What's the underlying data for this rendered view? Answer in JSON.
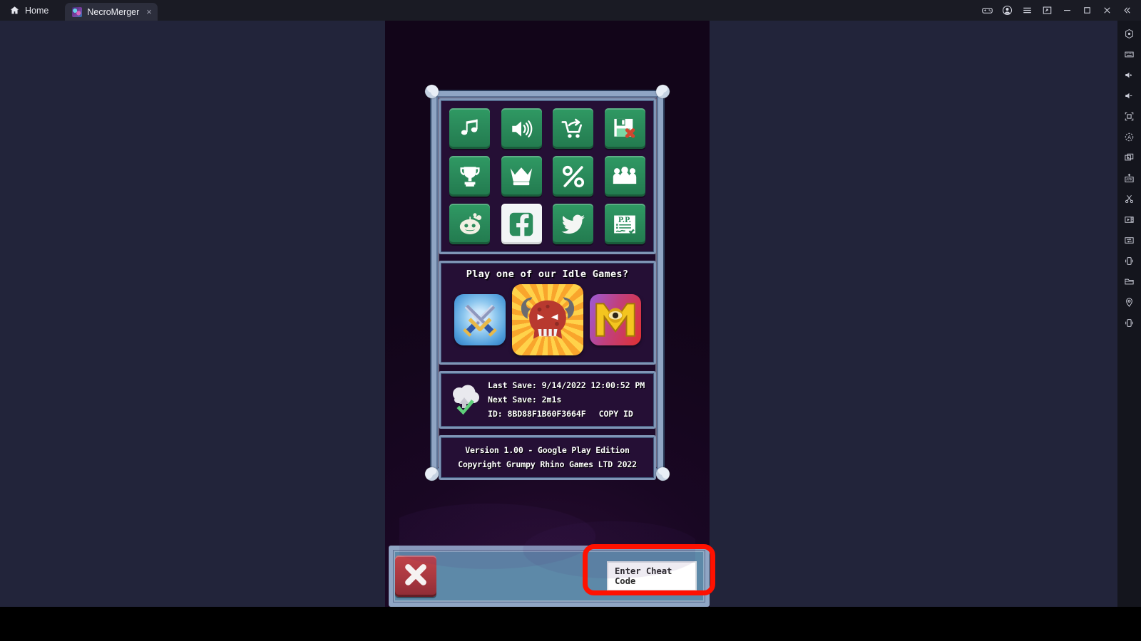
{
  "titlebar": {
    "home_label": "Home",
    "home_icon": "home-icon",
    "game_tab_label": "NecroMerger",
    "tab_close_glyph": "×",
    "buttons": [
      {
        "name": "gamepad-icon",
        "label": "Gamepad"
      },
      {
        "name": "account-icon",
        "label": "Account"
      },
      {
        "name": "hamburger-menu-icon",
        "label": "Menu"
      },
      {
        "name": "screenshot-icon",
        "label": "Screenshot"
      },
      {
        "name": "minimize-icon",
        "label": "Minimize"
      },
      {
        "name": "maximize-icon",
        "label": "Maximize"
      },
      {
        "name": "close-icon",
        "label": "Close"
      },
      {
        "name": "collapse-chevrons-icon",
        "label": "Collapse"
      }
    ]
  },
  "rail": {
    "items": [
      {
        "name": "fullscreen-hex-icon",
        "label": "Fullscreen"
      },
      {
        "name": "keyboard-icon",
        "label": "Keyboard mapping"
      },
      {
        "name": "volume-up-icon",
        "label": "Volume up"
      },
      {
        "name": "volume-down-icon",
        "label": "Volume down"
      },
      {
        "name": "resize-icon",
        "label": "Resize"
      },
      {
        "name": "rotate-auto-icon",
        "label": "Auto rotate"
      },
      {
        "name": "multi-instance-icon",
        "label": "Multi instance"
      },
      {
        "name": "apk-install-icon",
        "label": "Install APK"
      },
      {
        "name": "scissors-icon",
        "label": "Cut / macro"
      },
      {
        "name": "video-record-icon",
        "label": "Record"
      },
      {
        "name": "file-transfer-icon",
        "label": "File transfer"
      },
      {
        "name": "shake-icon",
        "label": "Shake"
      },
      {
        "name": "folder-icon",
        "label": "Shared folder"
      },
      {
        "name": "location-pin-icon",
        "label": "Location"
      },
      {
        "name": "rotate-device-icon",
        "label": "Rotate device"
      }
    ]
  },
  "game": {
    "settings_buttons": [
      {
        "name": "music-toggle-button",
        "icon": "music-note-icon",
        "label": "Music"
      },
      {
        "name": "sound-toggle-button",
        "icon": "speaker-icon",
        "label": "Sound"
      },
      {
        "name": "restore-purchases-button",
        "icon": "shopping-cart-icon",
        "label": "Restore Purchases"
      },
      {
        "name": "delete-save-button",
        "icon": "floppy-disk-delete-icon",
        "label": "Delete Save"
      },
      {
        "name": "achievements-button",
        "icon": "trophy-icon",
        "label": "Achievements"
      },
      {
        "name": "leaderboard-button",
        "icon": "crown-icon",
        "label": "Leaderboard"
      },
      {
        "name": "offers-button",
        "icon": "percent-icon",
        "label": "Offers"
      },
      {
        "name": "credits-button",
        "icon": "people-group-icon",
        "label": "Credits"
      },
      {
        "name": "reddit-link-button",
        "icon": "reddit-icon",
        "label": "Reddit"
      },
      {
        "name": "facebook-link-button",
        "icon": "facebook-icon",
        "label": "Facebook"
      },
      {
        "name": "twitter-link-button",
        "icon": "twitter-icon",
        "label": "Twitter"
      },
      {
        "name": "privacy-policy-button",
        "icon": "privacy-policy-icon",
        "label": "Privacy Policy"
      }
    ],
    "idle_games": {
      "title": "Play one of our Idle Games?",
      "items": [
        {
          "name": "idle-game-swords",
          "label": "Crossed Swords"
        },
        {
          "name": "idle-game-demon",
          "label": "Demon"
        },
        {
          "name": "idle-game-m",
          "label": "M"
        }
      ]
    },
    "save": {
      "cloud_icon": "cloud-save-check-icon",
      "last_save": "Last Save: 9/14/2022 12:00:52 PM",
      "next_save": "Next Save: 2m1s",
      "id_label": "ID: 8BD88F1B60F3664F",
      "copy_id_label": "COPY ID"
    },
    "version": {
      "line1": "Version 1.00 - Google Play Edition",
      "line2": "Copyright Grumpy Rhino Games LTD 2022"
    },
    "bottom": {
      "close_button_icon": "x-close-icon",
      "cheat_placeholder": "Enter Cheat Code"
    }
  },
  "colors": {
    "green_button": "#2b8c5c",
    "frame_blue": "#8fa5c4",
    "panel_bg": "#250f35",
    "red_button": "#a93840",
    "highlight_ring": "#ff1100",
    "bottom_bar": "#5d89a8"
  }
}
